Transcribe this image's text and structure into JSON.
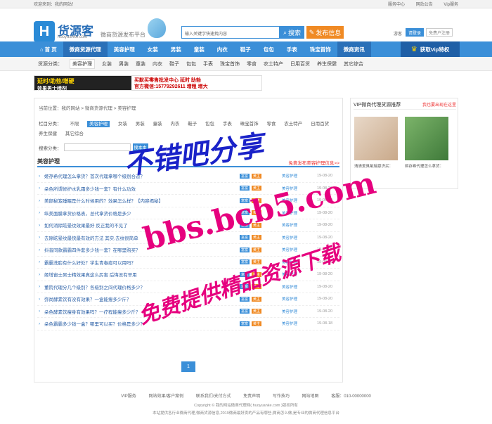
{
  "topbar": {
    "welcome": "欢迎来到：我的网站！",
    "links": [
      "服务中心",
      "网站公告",
      "Vip服务"
    ]
  },
  "header": {
    "logo_letter": "H",
    "logo_name": "货源客",
    "logo_domain": "huoyuanke.com",
    "slogan": "微商货源发布平台",
    "search_placeholder": "输入关键字快速找内容",
    "search_btn": "搜索",
    "publish_btn": "发布信息",
    "guest": "游客",
    "login": "请登录",
    "register": "免费户注册"
  },
  "nav": {
    "items": [
      "首 页",
      "微商货源代理",
      "美容护理",
      "女装",
      "男装",
      "童装",
      "内衣",
      "鞋子",
      "包包",
      "手表",
      "珠宝首饰",
      "微商资讯"
    ],
    "vip": "获取Vip特权"
  },
  "cats": {
    "label": "货源分类：",
    "items": [
      "美容护理",
      "女装",
      "男装",
      "童装",
      "内衣",
      "鞋子",
      "包包",
      "手表",
      "珠宝首饰",
      "零食",
      "农土特产",
      "日用百货",
      "养生保健",
      "其它综合"
    ]
  },
  "ad": {
    "left": "延时/助勃/增硬",
    "left2": "效果男士喷剂",
    "right1": "买默买零售批发中心  延时 助勃",
    "right2": "官方微信:15779292611  增粗 增大"
  },
  "main": {
    "crumb": "当前位置：我的网站 > 微商货源代理 > 美容护理",
    "filter_label": "栏目分类：",
    "filter_items": [
      "不限",
      "美容护理",
      "女装",
      "男装",
      "童装",
      "内衣",
      "鞋子",
      "包包",
      "手表",
      "珠宝首饰",
      "零食",
      "农土特产",
      "日用百货",
      "养生保健",
      "其它综合"
    ],
    "search_label": "搜索分类：",
    "search_btn": "搜本本",
    "list_title": "美容护理",
    "list_more": "免费发布美容护理信息>>",
    "rows": [
      {
        "t": "姬存希代理怎么拿货？首次代理拿哪个级别合适？",
        "d": "19-08-20"
      },
      {
        "t": "朵色所谓修护水乳霜多少钱一套？有什么功效",
        "d": "19-08-20"
      },
      {
        "t": "美颜秘笈睡眠是什么时候用的？效果怎么样？【内容揭秘】",
        "d": "19-08-20"
      },
      {
        "t": "纵美面膜拿货价格表，总代拿货价格是多少",
        "d": "19-08-20"
      },
      {
        "t": "如何消除眩晕纹效果最好 反正我的不见了",
        "d": "19-08-20"
      },
      {
        "t": "去除眩晕纹最快最有效的方法 其实,去纹很简单",
        "d": "19-08-20"
      },
      {
        "t": "抖音同款霸霸四件套多少钱一套？在哪里购买？",
        "d": "19-08-20"
      },
      {
        "t": "霸霸洗脸有什么好处？学生青春痘可以用吗？",
        "d": "19-08-20"
      },
      {
        "t": "姬增宙士男士精效果真这么厉害 后悔没有早用",
        "d": "19-08-20"
      },
      {
        "t": "董院代理分几个级别？各级别之间代理价格多少？",
        "d": "19-08-20"
      },
      {
        "t": "弥尚酵素饮有没有效果？一盒能瘦多少斤？",
        "d": "19-08-20"
      },
      {
        "t": "朵色酵素饮瘦身有效果吗？一疗程能瘦多少斤？",
        "d": "19-08-20"
      },
      {
        "t": "朵色霸霸多少钱一盒？哪里可以买？价格是多少？",
        "d": "19-08-18"
      }
    ],
    "row_badge1": "富富",
    "row_badge2": "黄主",
    "row_cat": "美容护理",
    "page": "1"
  },
  "side": {
    "title": "VIP微商代理货源推荐",
    "more": "我也要出现在这里",
    "cap1": "清清爱臭氧瑞恩济买：",
    "cap2": "姬存希代理怎么拿货："
  },
  "footer": {
    "links": [
      "VIP服务",
      "网站效果/客户案例",
      "联系我们/支付方式",
      "免责声明",
      "写作技巧",
      "网站地图",
      "客服：010-00000000"
    ],
    "copy1": "Copyright © 我的网站微商代理网( huoyuanke.com )版权所有",
    "copy2": "本站提供各行业微商代理,微商货源信息,2019微商最好卖的产品有哪些,微商怎么做,是专业的微商代理信息平台"
  },
  "watermark": {
    "line1": "不错吧分享",
    "line2": "bbs.bcb5.com",
    "line3": "免费提供精品资源下载"
  }
}
